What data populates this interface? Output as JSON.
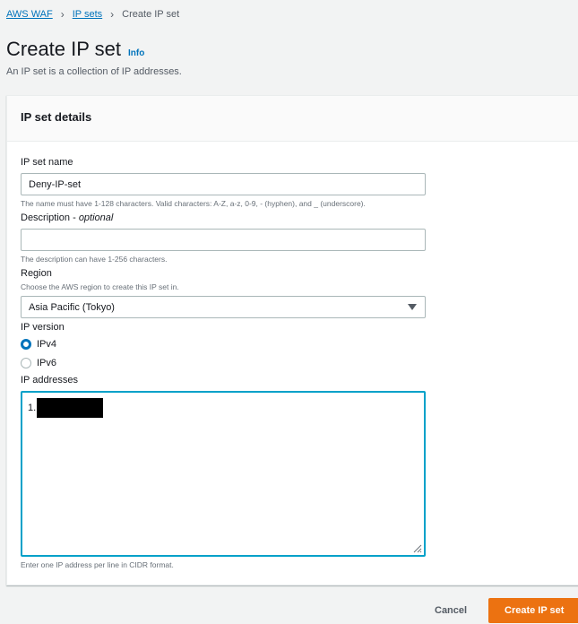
{
  "breadcrumb": {
    "root": "AWS WAF",
    "parent": "IP sets",
    "current": "Create IP set"
  },
  "page": {
    "title": "Create IP set",
    "info": "Info",
    "description": "An IP set is a collection of IP addresses."
  },
  "panel": {
    "title": "IP set details"
  },
  "fields": {
    "name": {
      "label": "IP set name",
      "value": "Deny-IP-set",
      "hint": "The name must have 1-128 characters. Valid characters: A-Z, a-z, 0-9, - (hyphen), and _ (underscore)."
    },
    "description": {
      "label": "Description",
      "optional": "optional",
      "value": "",
      "hint": "The description can have 1-256 characters."
    },
    "region": {
      "label": "Region",
      "hint": "Choose the AWS region to create this IP set in.",
      "selected": "Asia Pacific (Tokyo)"
    },
    "ip_version": {
      "label": "IP version",
      "options": [
        "IPv4",
        "IPv6"
      ],
      "selected": "IPv4"
    },
    "ip_addresses": {
      "label": "IP addresses",
      "line_prefix": "1.",
      "hint": "Enter one IP address per line in CIDR format."
    }
  },
  "actions": {
    "cancel": "Cancel",
    "create": "Create IP set"
  },
  "colors": {
    "primary": "#ec7211",
    "link": "#0073bb",
    "focus": "#00a1c9"
  }
}
